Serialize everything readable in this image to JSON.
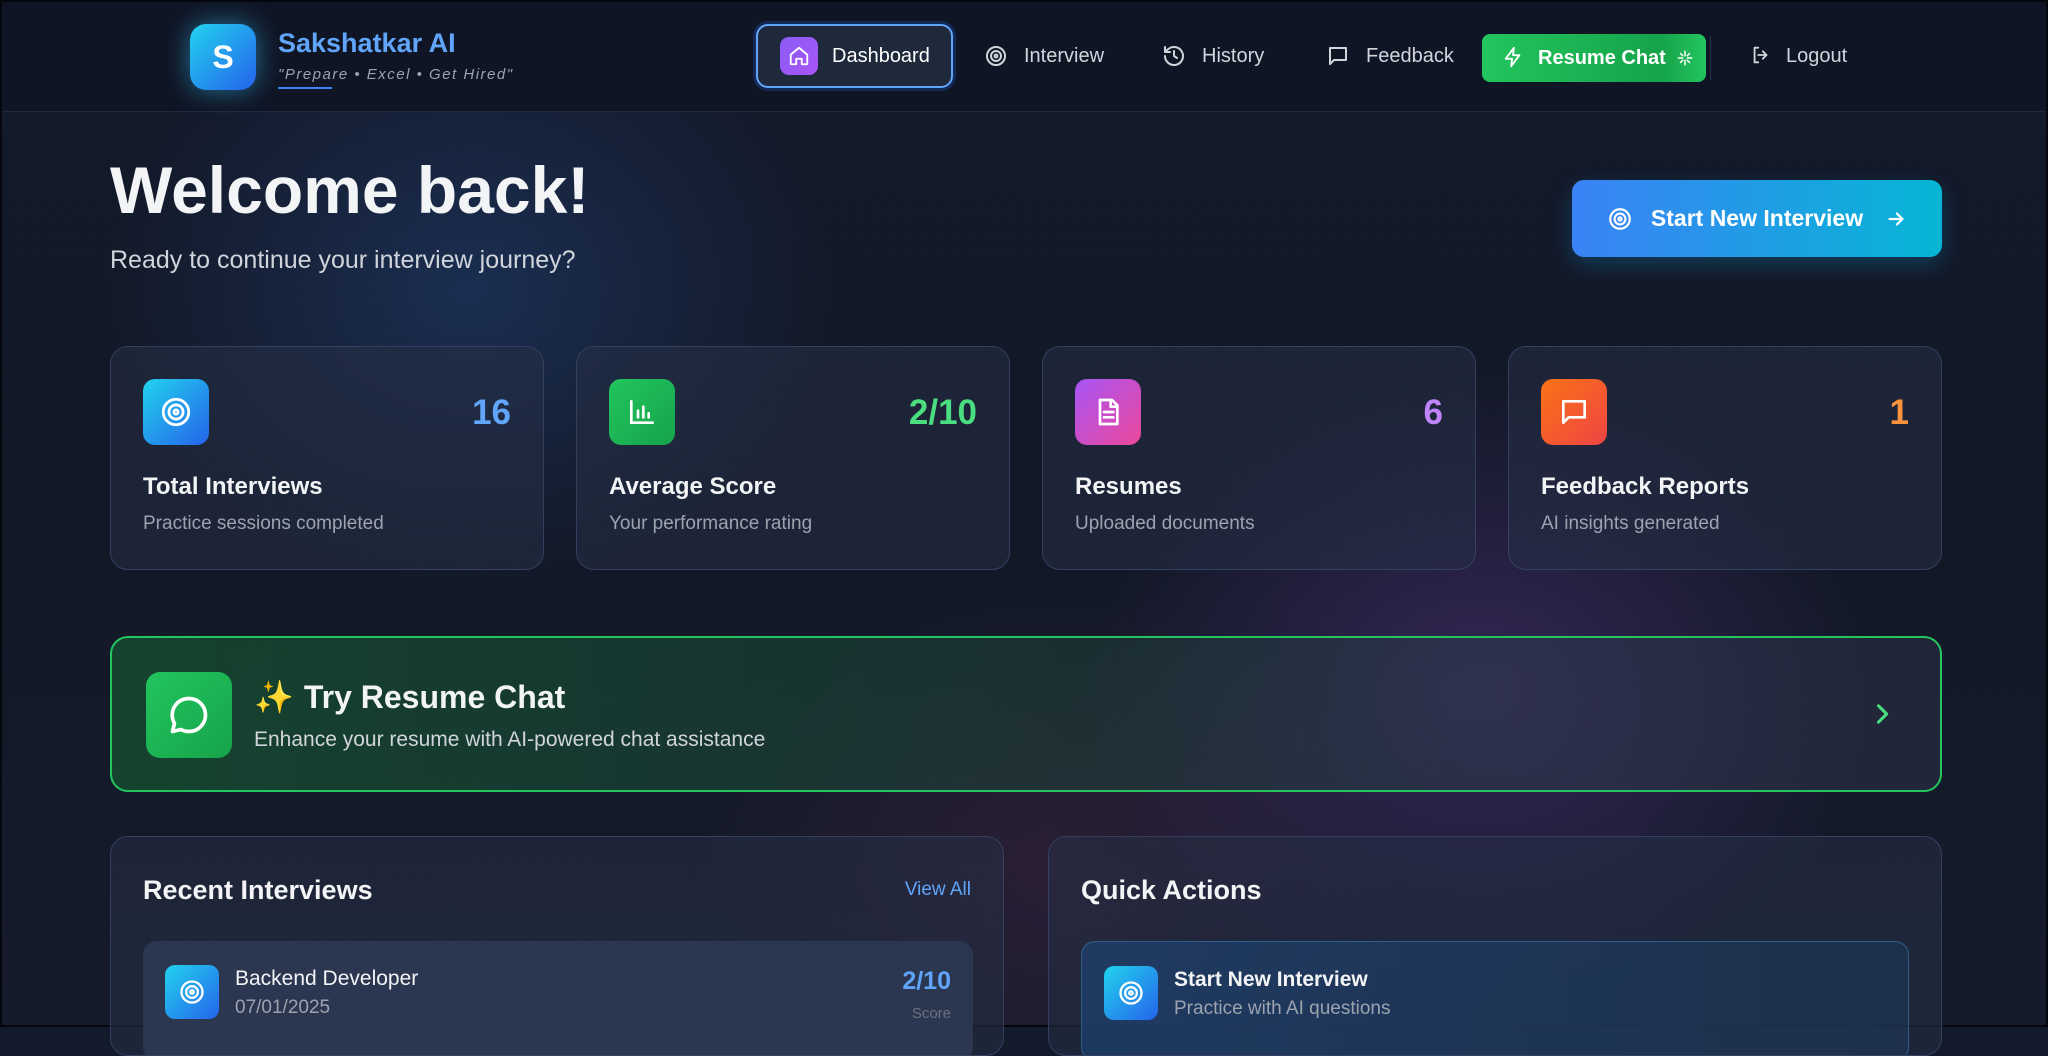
{
  "brand": {
    "logo_letter": "S",
    "name": "Sakshatkar AI",
    "tagline": "\"Prepare • Excel • Get Hired\""
  },
  "nav": {
    "dashboard": "Dashboard",
    "interview": "Interview",
    "history": "History",
    "feedback": "Feedback",
    "resume_chat": "Resume Chat",
    "logout": "Logout"
  },
  "hero": {
    "title": "Welcome back!",
    "subtitle": "Ready to continue your interview journey?",
    "cta": "Start New Interview"
  },
  "stats": [
    {
      "value": "16",
      "label": "Total Interviews",
      "desc": "Practice sessions completed",
      "icon": "target-icon",
      "color": "#60a5fa"
    },
    {
      "value": "2/10",
      "label": "Average Score",
      "desc": "Your performance rating",
      "icon": "bar-chart-icon",
      "color": "#4ade80"
    },
    {
      "value": "6",
      "label": "Resumes",
      "desc": "Uploaded documents",
      "icon": "document-icon",
      "color": "#c084fc"
    },
    {
      "value": "1",
      "label": "Feedback Reports",
      "desc": "AI insights generated",
      "icon": "message-square-icon",
      "color": "#fb923c"
    }
  ],
  "banner": {
    "sparkle": "✨",
    "title": "Try Resume Chat",
    "desc": "Enhance your resume with AI-powered chat assistance"
  },
  "recent": {
    "title": "Recent Interviews",
    "view_all": "View All",
    "items": [
      {
        "role": "Backend Developer",
        "date": "07/01/2025",
        "score": "2/10",
        "score_label": "Score"
      }
    ]
  },
  "quick_actions": {
    "title": "Quick Actions",
    "items": [
      {
        "title": "Start New Interview",
        "desc": "Practice with AI questions"
      }
    ]
  },
  "colors": {
    "accent_blue": "#3b82f6",
    "accent_green": "#22c55e",
    "background": "#131a2b"
  }
}
